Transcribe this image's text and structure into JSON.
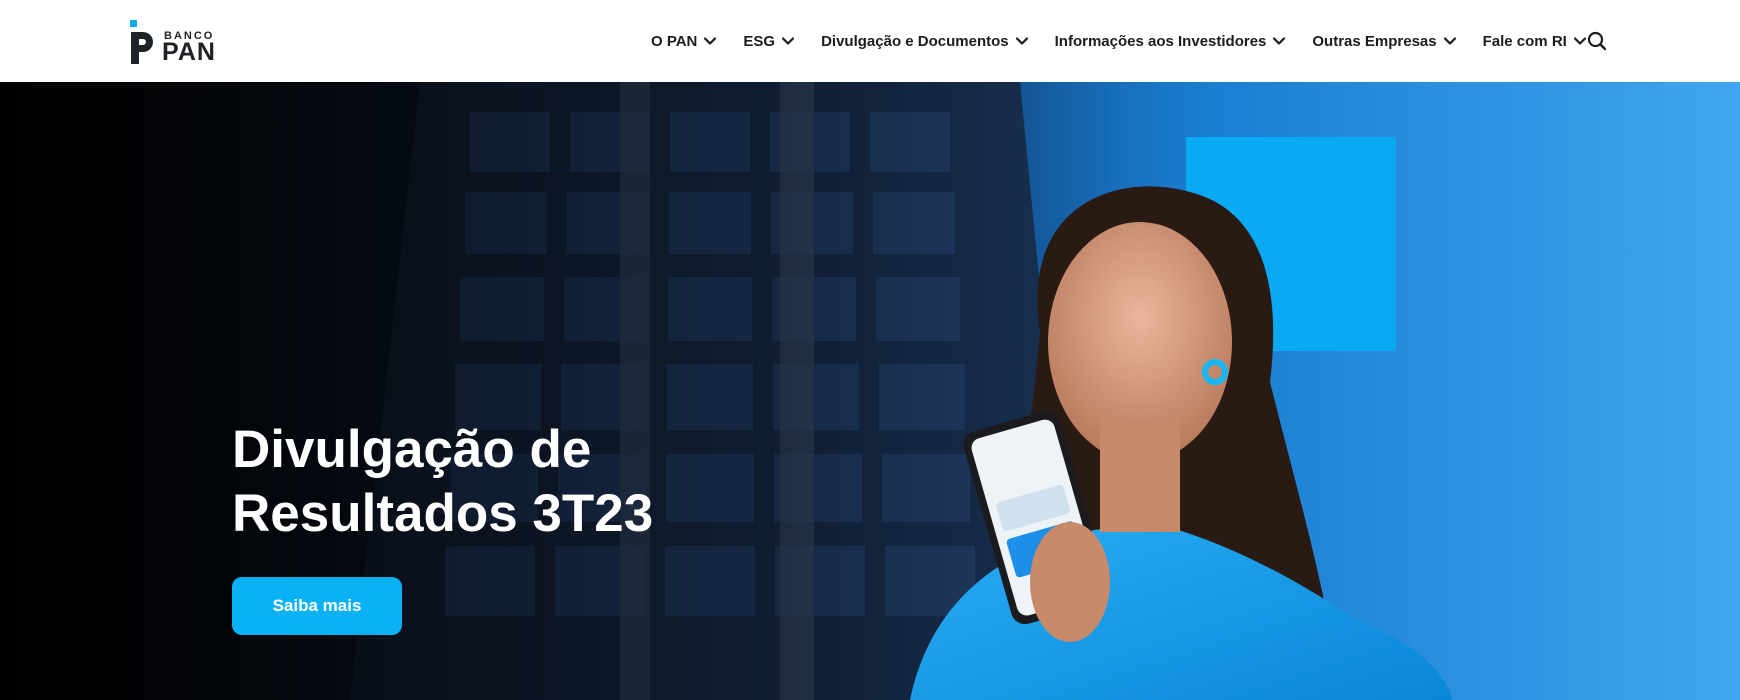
{
  "brand": {
    "top_line": "BANCO",
    "name": "PAN"
  },
  "nav": {
    "items": [
      {
        "label": "O PAN"
      },
      {
        "label": "ESG"
      },
      {
        "label": "Divulgação e Documentos"
      },
      {
        "label": "Informações aos Investidores"
      },
      {
        "label": "Outras Empresas"
      },
      {
        "label": "Fale com RI"
      }
    ],
    "search_icon": "search-icon",
    "dropdown_icon": "chevron-down-icon"
  },
  "hero": {
    "title_line1": "Divulgação de",
    "title_line2": "Resultados 3T23",
    "cta_label": "Saiba mais"
  },
  "colors": {
    "accent": "#0ab1f5",
    "text_dark": "#1a1d21",
    "header_bg": "#ffffff",
    "hero_blue": "#1592e4"
  }
}
